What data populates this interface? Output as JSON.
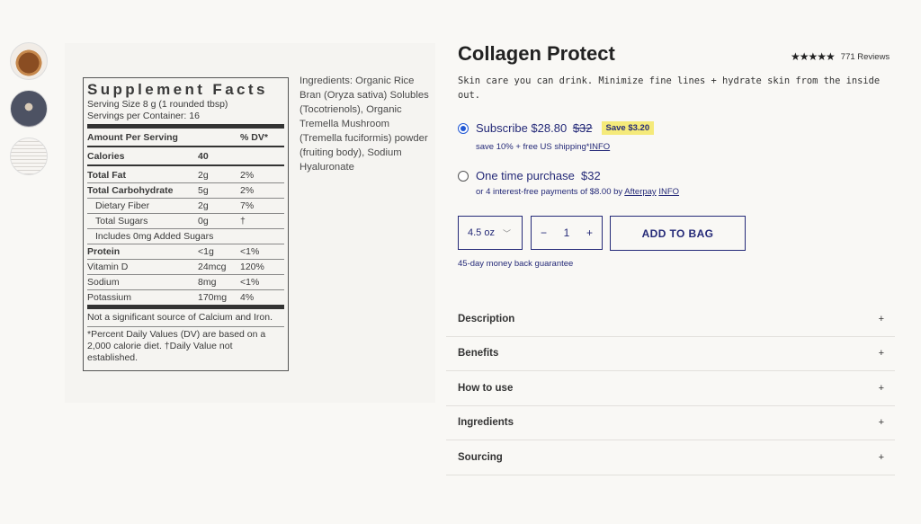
{
  "thumbnails": [
    {
      "icon": "jar-photo-icon"
    },
    {
      "icon": "powder-photo-icon"
    },
    {
      "icon": "label-photo-icon"
    }
  ],
  "supplement_facts": {
    "title": "Supplement Facts",
    "serving_size": "Serving Size 8 g (1 rounded tbsp)",
    "servings_per_container": "Servings per Container: 16",
    "header": {
      "label": "Amount Per Serving",
      "dv": "% DV*"
    },
    "calories": {
      "label": "Calories",
      "amount": "40"
    },
    "rows": [
      {
        "label": "Total Fat",
        "amount": "2g",
        "dv": "2%"
      },
      {
        "label": "Total Carbohydrate",
        "amount": "5g",
        "dv": "2%"
      },
      {
        "label": "Dietary Fiber",
        "amount": "2g",
        "dv": "7%"
      },
      {
        "label": "Total Sugars",
        "amount": "0g",
        "dv": "†"
      },
      {
        "label": "Includes 0mg Added Sugars",
        "amount": "",
        "dv": ""
      },
      {
        "label": "Protein",
        "amount": "<1g",
        "dv": "<1%"
      },
      {
        "label": "Vitamin D",
        "amount": "24mcg",
        "dv": "120%"
      },
      {
        "label": "Sodium",
        "amount": "8mg",
        "dv": "<1%"
      },
      {
        "label": "Potassium",
        "amount": "170mg",
        "dv": "4%"
      }
    ],
    "note1": "Not a significant source of Calcium and Iron.",
    "note2": "*Percent Daily Values (DV) are based on a 2,000 calorie diet.  †Daily Value not established."
  },
  "ingredients_text": "Ingredients: Organic Rice Bran (Oryza sativa) Solubles (Tocotrienols), Organic Tremella Mushroom (Tremella fuciformis) powder (fruiting body), Sodium Hyaluronate",
  "product": {
    "title": "Collagen Protect",
    "stars": "★★★★★",
    "reviews": "771 Reviews",
    "subtitle": "Skin care you can drink. Minimize fine lines + hydrate skin from the inside out."
  },
  "purchase": {
    "subscribe_label": "Subscribe $28.80",
    "subscribe_old_price": "$32",
    "save_badge": "Save $3.20",
    "subscribe_note": "save 10% + free US shipping*",
    "subscribe_info": "INFO",
    "onetime_label": "One time purchase  $32",
    "onetime_note": "or 4 interest-free payments of $8.00 by ",
    "afterpay": "Afterpay",
    "onetime_info": "INFO",
    "size": "4.5 oz",
    "quantity": "1",
    "minus": "−",
    "plus": "+",
    "add_to_bag": "ADD TO BAG",
    "guarantee": "45-day money back guarantee"
  },
  "accordion": [
    {
      "label": "Description",
      "toggle": "+"
    },
    {
      "label": "Benefits",
      "toggle": "+"
    },
    {
      "label": "How to use",
      "toggle": "+"
    },
    {
      "label": "Ingredients",
      "toggle": "+"
    },
    {
      "label": "Sourcing",
      "toggle": "+"
    }
  ],
  "colors": {
    "accent": "#252a78",
    "badge": "#f5ea7a",
    "radio": "#2158d4"
  }
}
